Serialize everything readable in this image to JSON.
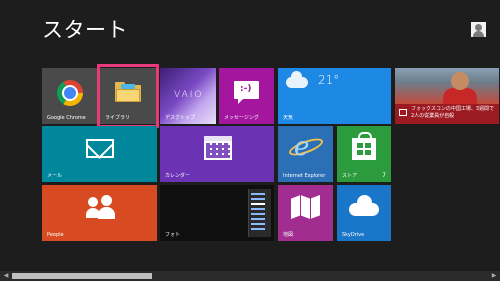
{
  "header": {
    "title": "スタート",
    "user_name": ""
  },
  "tiles": {
    "chrome": {
      "label": "Google Chrome"
    },
    "library": {
      "label": "ライブラリ"
    },
    "desktop": {
      "label": "デスクトップ",
      "wallpaper_text": "VAIO"
    },
    "messaging": {
      "label": "メッセージング",
      "icon_text": ":-)"
    },
    "weather": {
      "label": "天気",
      "temp": "21°",
      "lines": [
        "",
        "",
        ""
      ]
    },
    "news": {
      "label": "",
      "headline": "フォックスコンの中国工場、3週間で 2人の従業員が自殺"
    },
    "mail": {
      "label": "メール"
    },
    "calendar": {
      "label": "カレンダー"
    },
    "ie": {
      "label": "Internet Explorer"
    },
    "store": {
      "label": "ストア",
      "badge": "7"
    },
    "people": {
      "label": "People"
    },
    "photos": {
      "label": "フォト"
    },
    "maps": {
      "label": "地図"
    },
    "skydrive": {
      "label": "SkyDrive"
    }
  },
  "colors": {
    "background": "#1d1d1d",
    "highlight": "#e8397a",
    "messaging": "#a4169e",
    "weather": "#1e88e5",
    "mail": "#00879b",
    "calendar": "#6b32b4",
    "store": "#2b9b3d",
    "people": "#d84b22",
    "maps": "#a02d8f",
    "skydrive": "#1976c9"
  }
}
